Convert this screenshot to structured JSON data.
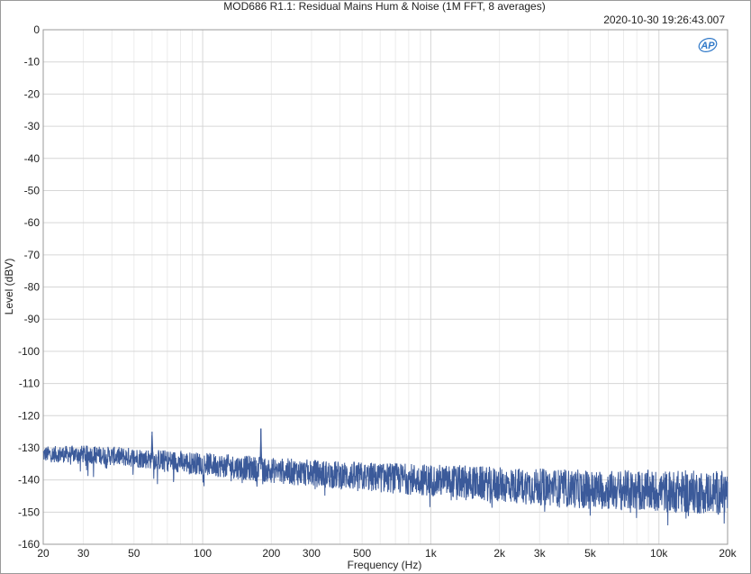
{
  "chart_data": {
    "type": "line",
    "title": "MOD686 R1.1: Residual Mains Hum & Noise (1M FFT, 8 averages)",
    "timestamp": "2020-10-30 19:26:43.007",
    "logo_text": "AP",
    "xlabel": "Frequency (Hz)",
    "ylabel": "Level (dBV)",
    "x_scale": "log",
    "xlim": [
      20,
      20000
    ],
    "ylim": [
      -160,
      0
    ],
    "grid": true,
    "x_ticks": [
      {
        "value": 20,
        "label": "20"
      },
      {
        "value": 30,
        "label": "30"
      },
      {
        "value": 50,
        "label": "50"
      },
      {
        "value": 100,
        "label": "100"
      },
      {
        "value": 200,
        "label": "200"
      },
      {
        "value": 300,
        "label": "300"
      },
      {
        "value": 500,
        "label": "500"
      },
      {
        "value": 1000,
        "label": "1k"
      },
      {
        "value": 2000,
        "label": "2k"
      },
      {
        "value": 3000,
        "label": "3k"
      },
      {
        "value": 5000,
        "label": "5k"
      },
      {
        "value": 10000,
        "label": "10k"
      },
      {
        "value": 20000,
        "label": "20k"
      }
    ],
    "y_ticks": [
      0,
      -10,
      -20,
      -30,
      -40,
      -50,
      -60,
      -70,
      -80,
      -90,
      -100,
      -110,
      -120,
      -130,
      -140,
      -150,
      -160
    ],
    "series": [
      {
        "color": "#3b5a9a",
        "floor": [
          {
            "x": 20,
            "y": -132
          },
          {
            "x": 30,
            "y": -132
          },
          {
            "x": 50,
            "y": -133
          },
          {
            "x": 100,
            "y": -135
          },
          {
            "x": 200,
            "y": -137
          },
          {
            "x": 500,
            "y": -139
          },
          {
            "x": 1000,
            "y": -140
          },
          {
            "x": 2000,
            "y": -141.5
          },
          {
            "x": 5000,
            "y": -143
          },
          {
            "x": 10000,
            "y": -143.5
          },
          {
            "x": 20000,
            "y": -144
          }
        ],
        "peaks": [
          {
            "x": 60,
            "y": -125
          },
          {
            "x": 180,
            "y": -124
          }
        ]
      }
    ]
  }
}
